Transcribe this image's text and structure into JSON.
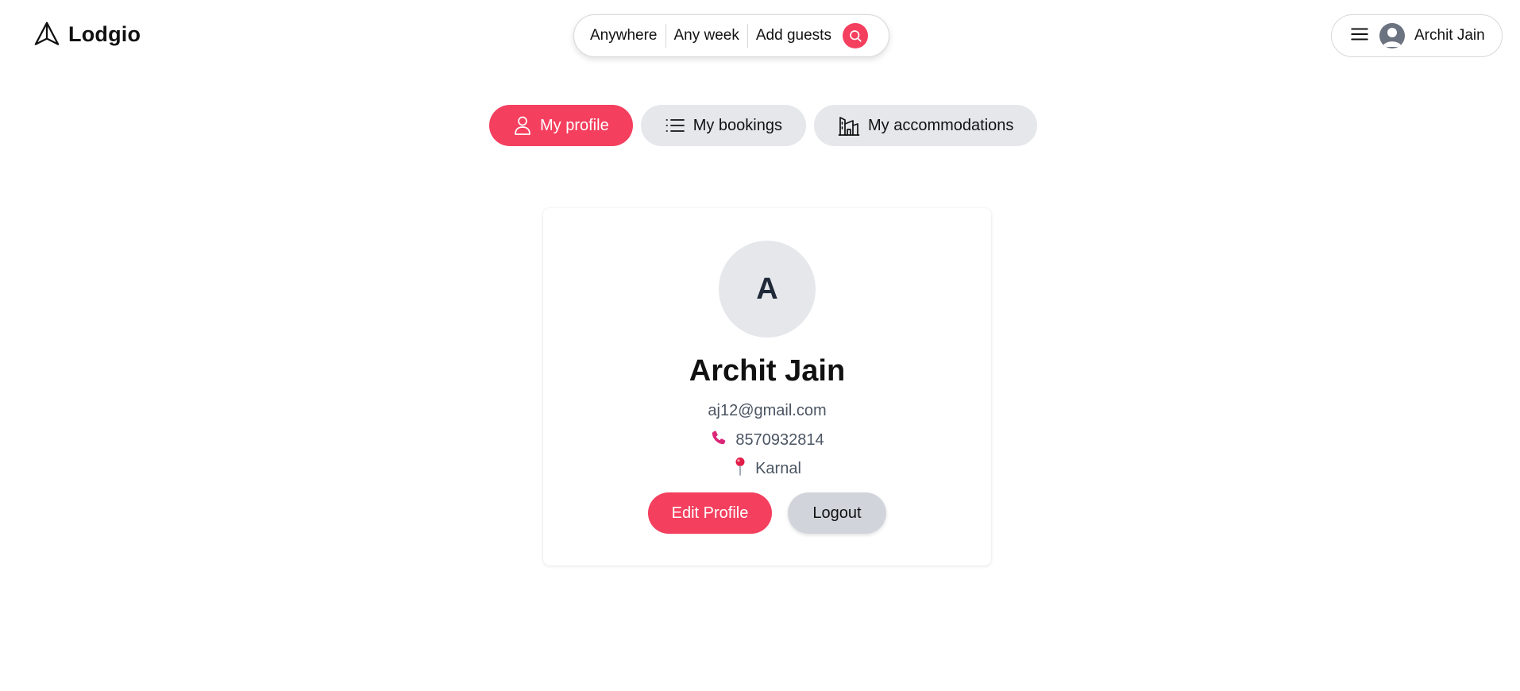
{
  "header": {
    "brand": "Lodgio",
    "search": {
      "location": "Anywhere",
      "dates": "Any week",
      "guests": "Add guests"
    },
    "user_name": "Archit Jain"
  },
  "tabs": [
    {
      "label": "My profile",
      "icon": "user-icon",
      "active": true
    },
    {
      "label": "My bookings",
      "icon": "list-icon",
      "active": false
    },
    {
      "label": "My accommodations",
      "icon": "building-icon",
      "active": false
    }
  ],
  "profile": {
    "initial": "A",
    "name": "Archit Jain",
    "email": "aj12@gmail.com",
    "phone": "8570932814",
    "location": "Karnal",
    "edit_label": "Edit Profile",
    "logout_label": "Logout"
  },
  "colors": {
    "accent": "#f43f5e",
    "tab_inactive": "#e5e7eb",
    "logout_button": "#d1d5db"
  }
}
